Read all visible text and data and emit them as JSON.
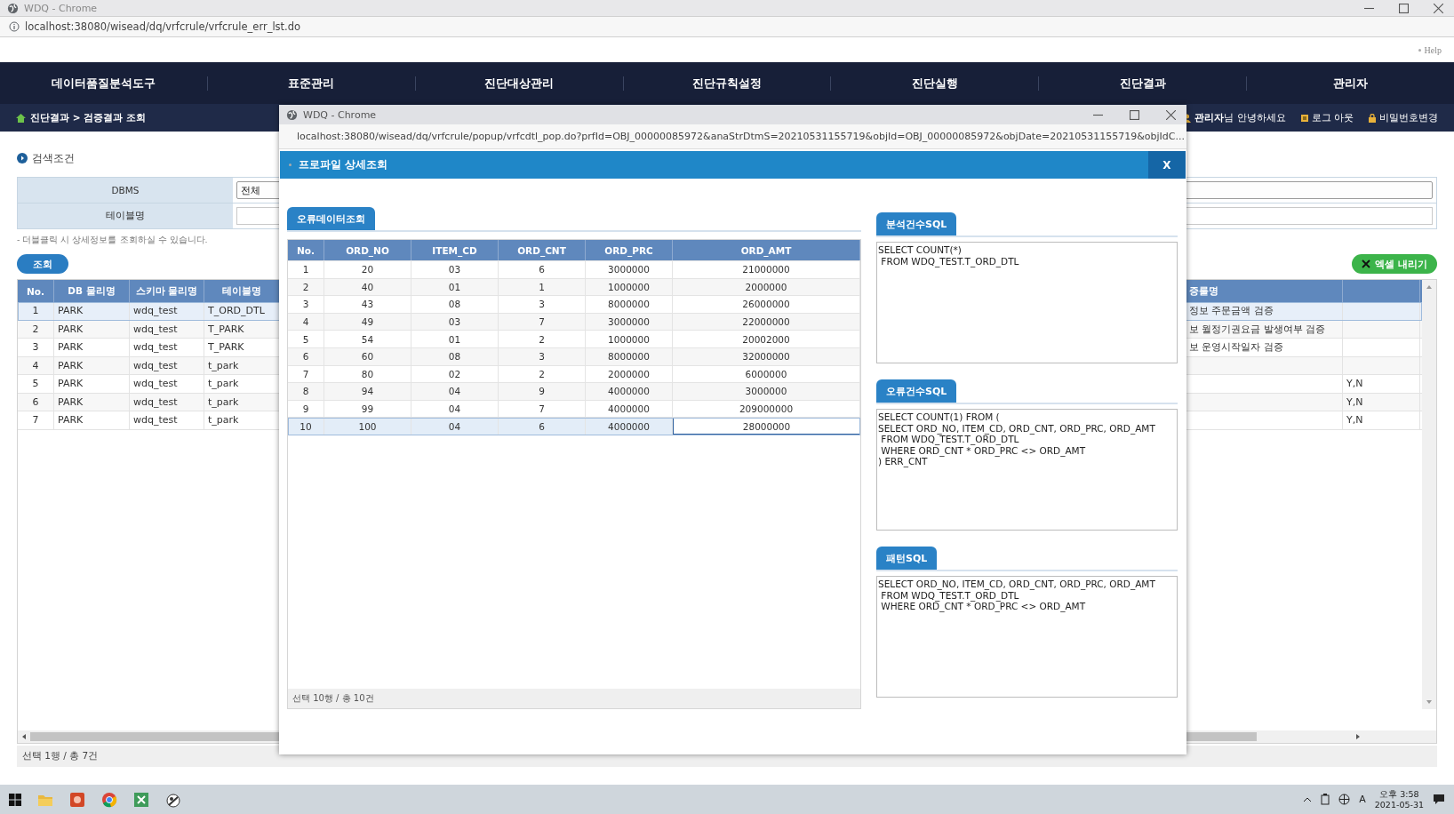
{
  "browser": {
    "title": "WDQ - Chrome",
    "url": "localhost:38080/wisead/dq/vrfcrule/vrfcrule_err_lst.do"
  },
  "header": {
    "help": "Help"
  },
  "nav": {
    "items": [
      {
        "label": "데이터품질분석도구",
        "kind": "logo"
      },
      {
        "label": "표준관리",
        "kind": "menu"
      },
      {
        "label": "진단대상관리",
        "kind": "menu"
      },
      {
        "label": "진단규칙설정",
        "kind": "menu"
      },
      {
        "label": "진단실행",
        "kind": "menu"
      },
      {
        "label": "진단결과",
        "kind": "menu"
      },
      {
        "label": "관리자",
        "kind": "menu"
      }
    ]
  },
  "breadcrumb": "진단결과 > 검증결과 조회",
  "user_menu": {
    "greeting": "**관리자**님 안녕하세요",
    "logout": "로그 아웃",
    "change_password": "비밀번호변경"
  },
  "search": {
    "title": "검색조건",
    "fields": [
      {
        "label": "DBMS",
        "kind": "select",
        "value": "전체"
      },
      {
        "label": "테이블명",
        "kind": "text"
      }
    ],
    "hint": "- 더블클릭 시 상세정보를 조회하실 수 있습니다.",
    "button": "조회"
  },
  "export_button": "엑셀 내리기",
  "grid": {
    "columns": [
      "No.",
      "DB 물리명",
      "스키마 물리명",
      "테이블명",
      "증룰명"
    ],
    "rows": [
      {
        "no": "1",
        "db": "PARK",
        "schema": "wdq_test",
        "table": "T_ORD_DTL",
        "column_5": "정보 주문금액 검증",
        "selected": true
      },
      {
        "no": "2",
        "db": "PARK",
        "schema": "wdq_test",
        "table": "T_PARK",
        "column_5": "보 월정기권요금  발생여부 검증",
        "selected": false
      },
      {
        "no": "3",
        "db": "PARK",
        "schema": "wdq_test",
        "table": "T_PARK",
        "column_5": "보 운영시작일자 검증",
        "selected": false
      },
      {
        "no": "4",
        "db": "PARK",
        "schema": "wdq_test",
        "table": "t_park",
        "selected": false
      },
      {
        "no": "5",
        "db": "PARK",
        "schema": "wdq_test",
        "table": "t_park",
        "column_6": "Y,N",
        "selected": false
      },
      {
        "no": "6",
        "db": "PARK",
        "schema": "wdq_test",
        "table": "t_park",
        "column_6": "Y,N",
        "selected": false
      },
      {
        "no": "7",
        "db": "PARK",
        "schema": "wdq_test",
        "table": "t_park",
        "column_6": "Y,N",
        "selected": false
      }
    ],
    "status": "선택 1행 / 총 7건"
  },
  "popup": {
    "title": "WDQ - Chrome",
    "url": "localhost:38080/wisead/dq/vrfcrule/popup/vrfcdtl_pop.do?prfId=OBJ_00000085972&anaStrDtmS=20210531155719&objId=OBJ_00000085972&objDate=20210531155719&objIdC...",
    "header": "프로파일 상세조회",
    "close": "X",
    "tab": "오류데이터조회",
    "table": {
      "columns": [
        "No.",
        "ORD_NO",
        "ITEM_CD",
        "ORD_CNT",
        "ORD_PRC",
        "ORD_AMT"
      ],
      "rows": [
        {
          "cells": [
            "1",
            "20",
            "03",
            "6",
            "3000000",
            "21000000"
          ],
          "selected": false,
          "focused": false
        },
        {
          "cells": [
            "2",
            "40",
            "01",
            "1",
            "1000000",
            "2000000"
          ],
          "selected": false,
          "focused": false
        },
        {
          "cells": [
            "3",
            "43",
            "08",
            "3",
            "8000000",
            "26000000"
          ],
          "selected": false,
          "focused": false
        },
        {
          "cells": [
            "4",
            "49",
            "03",
            "7",
            "3000000",
            "22000000"
          ],
          "selected": false,
          "focused": false
        },
        {
          "cells": [
            "5",
            "54",
            "01",
            "2",
            "1000000",
            "20002000"
          ],
          "selected": false,
          "focused": false
        },
        {
          "cells": [
            "6",
            "60",
            "08",
            "3",
            "8000000",
            "32000000"
          ],
          "selected": false,
          "focused": false
        },
        {
          "cells": [
            "7",
            "80",
            "02",
            "2",
            "2000000",
            "6000000"
          ],
          "selected": false,
          "focused": false
        },
        {
          "cells": [
            "8",
            "94",
            "04",
            "9",
            "4000000",
            "3000000"
          ],
          "selected": false,
          "focused": false
        },
        {
          "cells": [
            "9",
            "99",
            "04",
            "7",
            "4000000",
            "209000000"
          ],
          "selected": false,
          "focused": false
        },
        {
          "cells": [
            "10",
            "100",
            "04",
            "6",
            "4000000",
            "28000000"
          ],
          "selected": true,
          "focused": true
        }
      ],
      "status": "선택 10행 / 총 10건"
    },
    "sql_panels": [
      {
        "tab": "분석건수SQL",
        "sql": "SELECT COUNT(*)\n FROM WDQ_TEST.T_ORD_DTL"
      },
      {
        "tab": "오류건수SQL",
        "sql": "SELECT COUNT(1) FROM (\nSELECT ORD_NO, ITEM_CD, ORD_CNT, ORD_PRC, ORD_AMT\n FROM WDQ_TEST.T_ORD_DTL\n WHERE ORD_CNT * ORD_PRC <> ORD_AMT\n) ERR_CNT"
      },
      {
        "tab": "패턴SQL",
        "sql": "SELECT ORD_NO, ITEM_CD, ORD_CNT, ORD_PRC, ORD_AMT\n FROM WDQ_TEST.T_ORD_DTL\n WHERE ORD_CNT * ORD_PRC <> ORD_AMT"
      }
    ]
  },
  "taskbar": {
    "apps": [
      {
        "kind": "folder"
      },
      {
        "kind": "slides"
      },
      {
        "kind": "browser"
      },
      {
        "kind": "sheet"
      },
      {
        "kind": "app"
      }
    ],
    "ime": "A",
    "time": "오후 3:58",
    "date": "2021-05-31"
  }
}
